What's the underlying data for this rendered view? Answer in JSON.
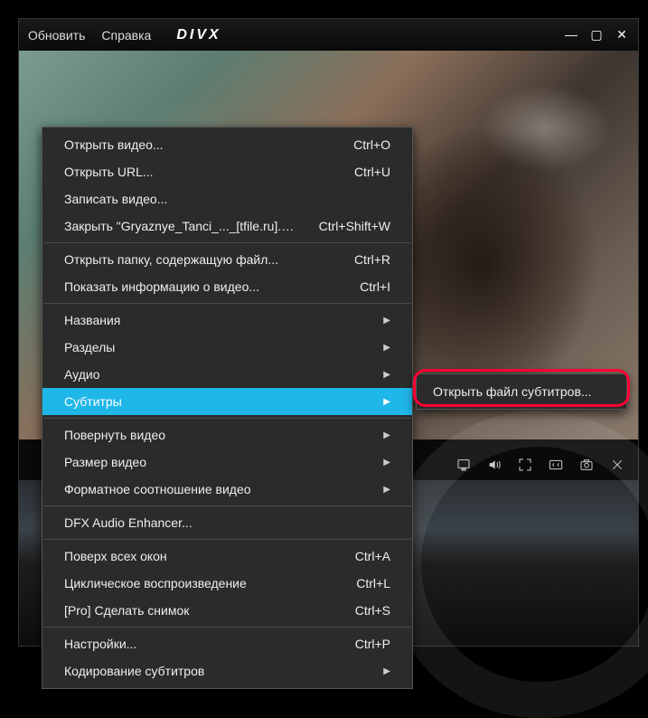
{
  "titlebar": {
    "menu_update": "Обновить",
    "menu_help": "Справка",
    "logo": "DIVX"
  },
  "context_menu": {
    "open_video": "Открыть видео...",
    "open_video_sc": "Ctrl+O",
    "open_url": "Открыть URL...",
    "open_url_sc": "Ctrl+U",
    "record_video": "Записать видео...",
    "close_file": "Закрыть \"Gryaznye_Tanci_..._[tfile.ru].avi\"",
    "close_file_sc": "Ctrl+Shift+W",
    "open_folder": "Открыть папку, содержащую файл...",
    "open_folder_sc": "Ctrl+R",
    "show_info": "Показать информацию о видео...",
    "show_info_sc": "Ctrl+I",
    "titles": "Названия",
    "chapters": "Разделы",
    "audio": "Аудио",
    "subtitles": "Субтитры",
    "rotate_video": "Повернуть видео",
    "video_size": "Размер видео",
    "aspect_ratio": "Форматное соотношение видео",
    "dfx": "DFX Audio Enhancer...",
    "always_on_top": "Поверх всех окон",
    "always_on_top_sc": "Ctrl+A",
    "loop": "Циклическое воспроизведение",
    "loop_sc": "Ctrl+L",
    "snapshot": "[Pro] Сделать снимок",
    "snapshot_sc": "Ctrl+S",
    "settings": "Настройки...",
    "settings_sc": "Ctrl+P",
    "subtitle_encoding": "Кодирование субтитров"
  },
  "submenu": {
    "open_subtitle_file": "Открыть файл субтитров..."
  }
}
